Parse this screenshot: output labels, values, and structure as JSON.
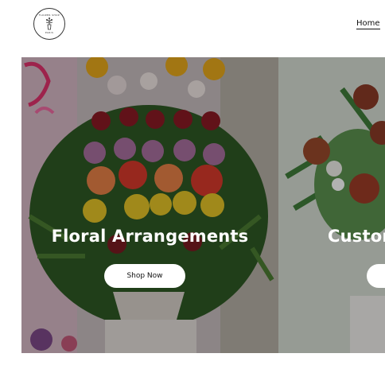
{
  "header": {
    "logo": {
      "name": "florist-logo",
      "text_top": "FLOWER SHOP",
      "text_bottom": "PARIS"
    },
    "nav": {
      "home_label": "Home"
    }
  },
  "slides": [
    {
      "title": "Floral Arrangements",
      "button_label": "Shop Now"
    },
    {
      "title": "Custom",
      "button_label": ""
    }
  ],
  "colors": {
    "overlay": "rgba(0,0,0,0.30)",
    "button_bg": "#ffffff",
    "title_text": "#ffffff"
  }
}
